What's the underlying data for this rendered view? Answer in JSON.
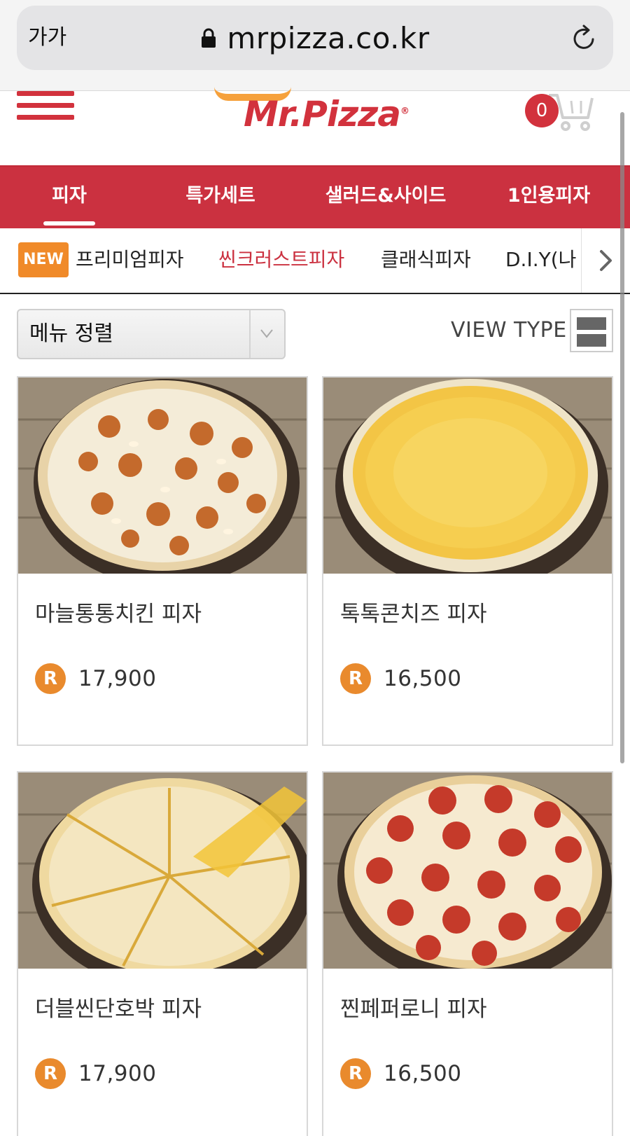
{
  "browser": {
    "text_size_label": "가가",
    "url": "mrpizza.co.kr"
  },
  "header": {
    "logo_text": "Mr.Pizza",
    "cart_count": "0"
  },
  "category_nav": {
    "tabs": [
      {
        "label": "피자",
        "active": true
      },
      {
        "label": "특가세트",
        "active": false
      },
      {
        "label": "샐러드&사이드",
        "active": false
      },
      {
        "label": "1인용피자",
        "active": false
      }
    ]
  },
  "sub_nav": {
    "new_badge": "NEW",
    "items": [
      {
        "label": "프리미엄피자",
        "active": false
      },
      {
        "label": "씬크러스트피자",
        "active": true
      },
      {
        "label": "클래식피자",
        "active": false
      },
      {
        "label": "D.I.Y(나",
        "active": false
      }
    ]
  },
  "toolbar": {
    "sort_label": "메뉴 정렬",
    "view_type_label": "VIEW TYPE"
  },
  "products": [
    {
      "name": "마늘통통치킨 피자",
      "price_symbol": "R",
      "price": "17,900"
    },
    {
      "name": "톡톡콘치즈 피자",
      "price_symbol": "R",
      "price": "16,500"
    },
    {
      "name": "더블씬단호박 피자",
      "price_symbol": "R",
      "price": "17,900"
    },
    {
      "name": "찐페퍼로니 피자",
      "price_symbol": "R",
      "price": "16,500"
    }
  ],
  "colors": {
    "brand_red": "#cb3140",
    "badge_orange": "#f08a29",
    "price_badge": "#e98a2d"
  }
}
